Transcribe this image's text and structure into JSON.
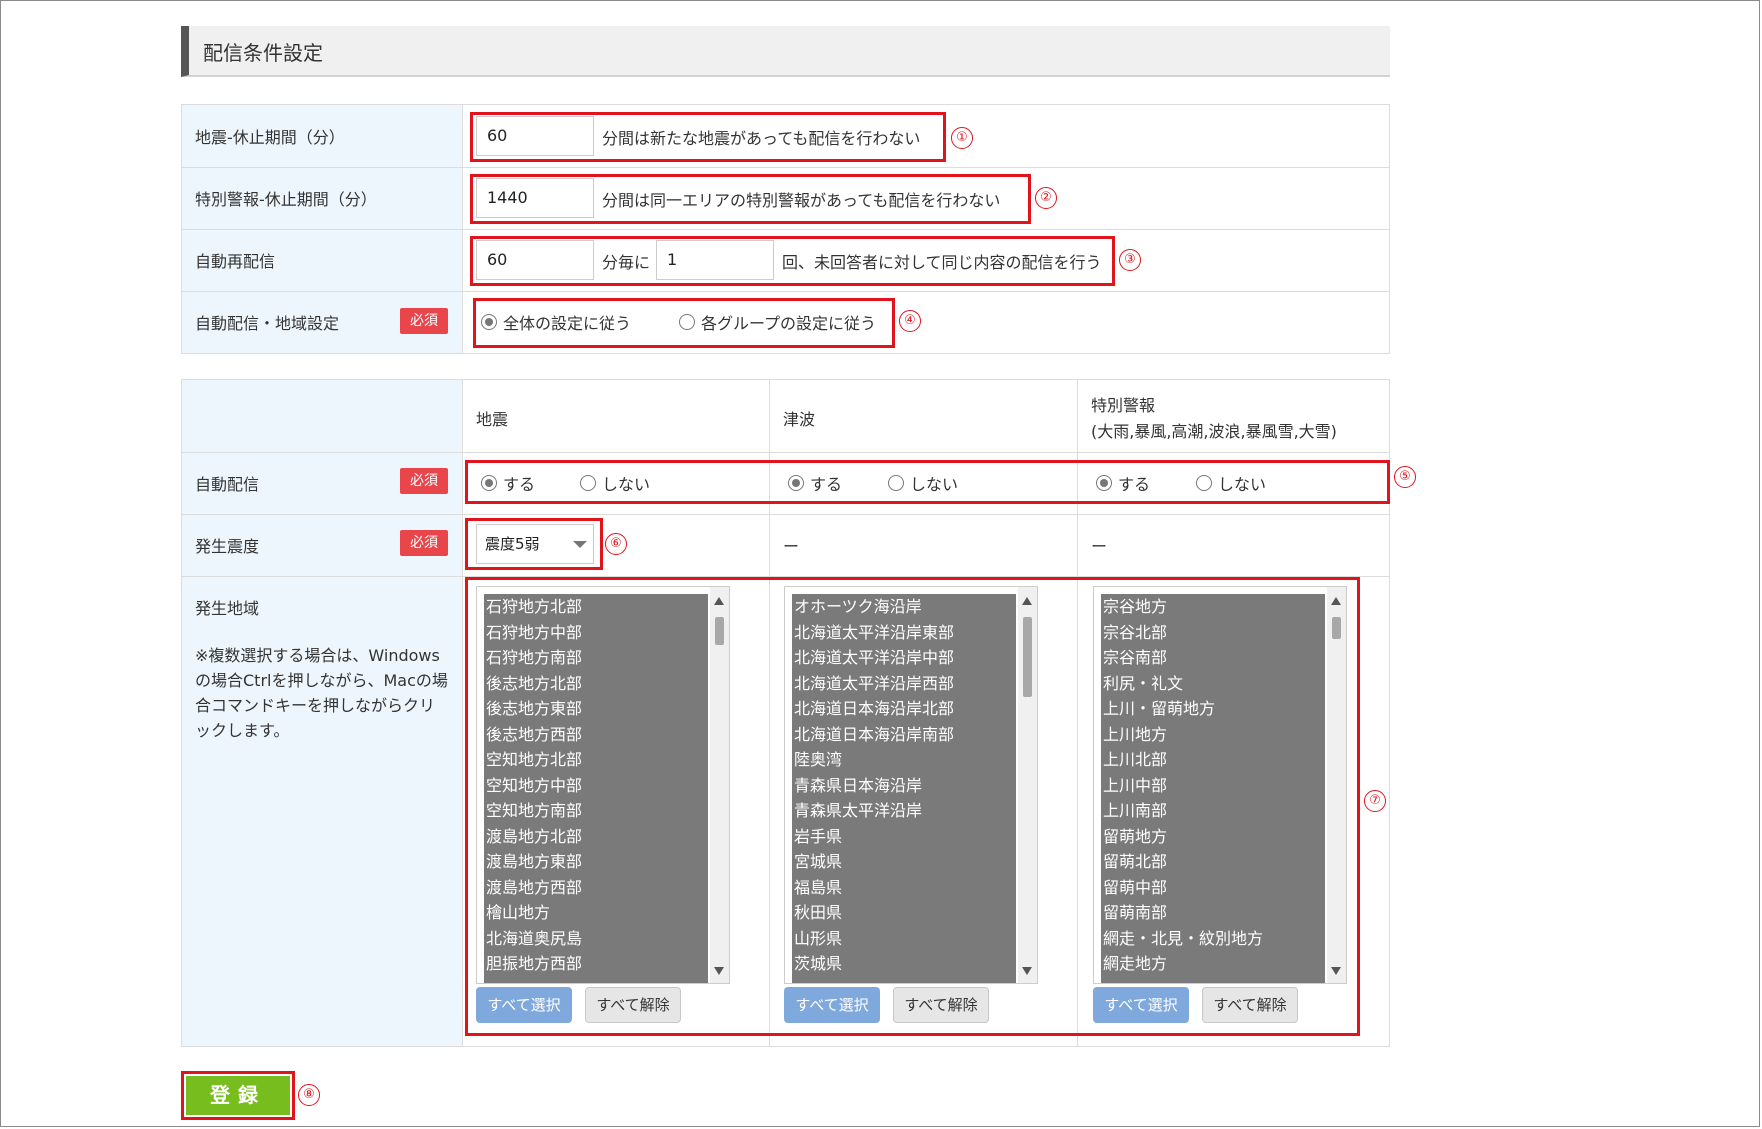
{
  "section_title": "配信条件設定",
  "settings": {
    "quake_rest": {
      "label": "地震-休止期間（分）",
      "value": "60",
      "suffix": "分間は新たな地震があっても配信を行わない",
      "marker": "①"
    },
    "warning_rest": {
      "label": "特別警報-休止期間（分）",
      "value": "1440",
      "suffix": "分間は同一エリアの特別警報があっても配信を行わない",
      "marker": "②"
    },
    "redelivery": {
      "label": "自動再配信",
      "interval": "60",
      "mid_text": "分毎に",
      "count": "1",
      "suffix": "回、未回答者に対して同じ内容の配信を行う",
      "marker": "③"
    },
    "region_setting": {
      "label": "自動配信・地域設定",
      "required": "必須",
      "options": [
        "全体の設定に従う",
        "各グループの設定に従う"
      ],
      "selected": 0,
      "marker": "④"
    }
  },
  "conditions": {
    "columns": [
      "地震",
      "津波",
      "特別警報\n(大雨,暴風,高潮,波浪,暴風雪,大雪)"
    ],
    "auto_delivery": {
      "label": "自動配信",
      "required": "必須",
      "on_label": "する",
      "off_label": "しない",
      "marker": "⑤"
    },
    "intensity": {
      "label": "発生震度",
      "required": "必須",
      "selected": "震度5弱",
      "tsunami": "ー",
      "warning": "ー",
      "marker": "⑥"
    },
    "area": {
      "label": "発生地域",
      "note": "※複数選択する場合は、Windowsの場合Ctrlを押しながら、Macの場合コマンドキーを押しながらクリックします。",
      "marker": "⑦",
      "select_all": "すべて選択",
      "clear_all": "すべて解除",
      "lists": [
        [
          "石狩地方北部",
          "石狩地方中部",
          "石狩地方南部",
          "後志地方北部",
          "後志地方東部",
          "後志地方西部",
          "空知地方北部",
          "空知地方中部",
          "空知地方南部",
          "渡島地方北部",
          "渡島地方東部",
          "渡島地方西部",
          "檜山地方",
          "北海道奥尻島",
          "胆振地方西部"
        ],
        [
          "オホーツク海沿岸",
          "北海道太平洋沿岸東部",
          "北海道太平洋沿岸中部",
          "北海道太平洋沿岸西部",
          "北海道日本海沿岸北部",
          "北海道日本海沿岸南部",
          "陸奥湾",
          "青森県日本海沿岸",
          "青森県太平洋沿岸",
          "岩手県",
          "宮城県",
          "福島県",
          "秋田県",
          "山形県",
          "茨城県"
        ],
        [
          "宗谷地方",
          "宗谷北部",
          "宗谷南部",
          "利尻・礼文",
          "上川・留萌地方",
          "上川地方",
          "上川北部",
          "上川中部",
          "上川南部",
          "留萌地方",
          "留萌北部",
          "留萌中部",
          "留萌南部",
          "網走・北見・紋別地方",
          "網走地方"
        ]
      ]
    }
  },
  "submit": {
    "label": "登録",
    "marker": "⑧"
  }
}
